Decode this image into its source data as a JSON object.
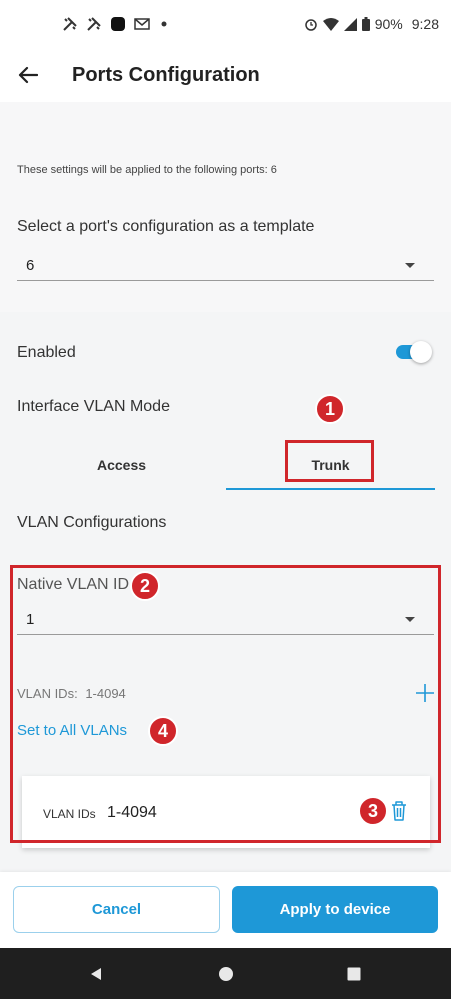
{
  "status_bar": {
    "battery": "90%",
    "time": "9:28",
    "left_icons": [
      "tools-icon",
      "tools-icon",
      "app-icon",
      "mail-icon",
      "dot-icon"
    ],
    "right_icons": [
      "alarm-icon",
      "wifi-icon",
      "signal-icon",
      "battery-icon"
    ]
  },
  "header": {
    "title": "Ports Configuration",
    "back_icon": "arrow-left-icon"
  },
  "ports_info": "These settings will be applied to the following ports: 6",
  "template": {
    "label": "Select a port's configuration as a template",
    "value": "6"
  },
  "enabled": {
    "label": "Enabled",
    "on": true
  },
  "vlan_mode": {
    "label": "Interface VLAN Mode",
    "tabs": [
      "Access",
      "Trunk"
    ],
    "selected": "Trunk"
  },
  "vlan_config": {
    "label": "VLAN Configurations",
    "native_label": "Native VLAN ID",
    "native_value": "1",
    "ids_label": "VLAN IDs:",
    "ids_range": "1-4094",
    "set_all": "Set to All VLANs",
    "card": {
      "key": "VLAN IDs",
      "value": "1-4094"
    }
  },
  "annotations": [
    "1",
    "2",
    "3",
    "4"
  ],
  "buttons": {
    "cancel": "Cancel",
    "apply": "Apply to device"
  },
  "colors": {
    "accent": "#1e98d7",
    "annotation": "#d0262b"
  }
}
